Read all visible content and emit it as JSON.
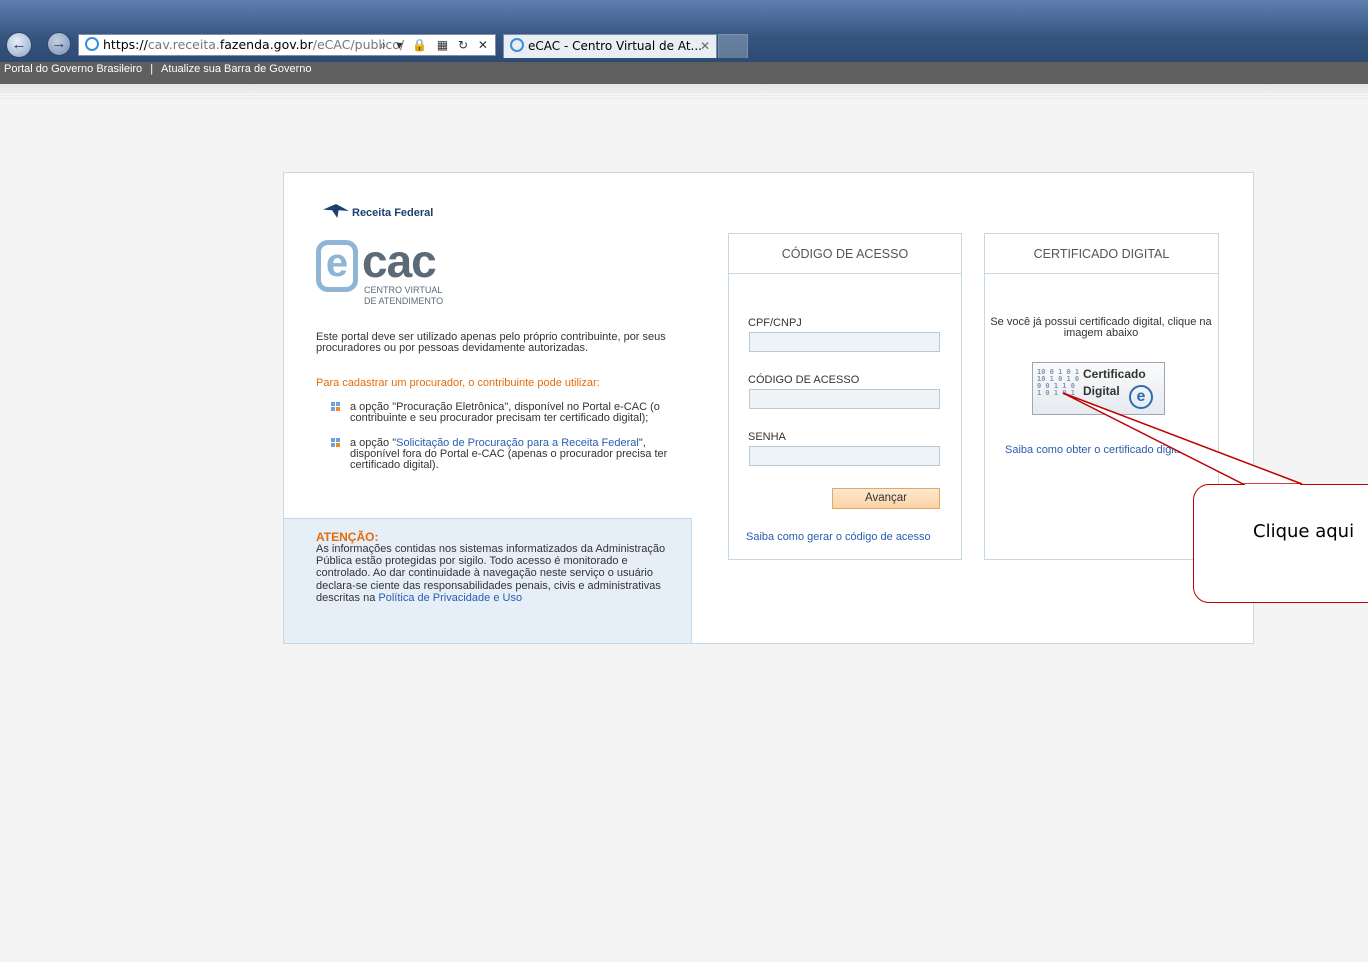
{
  "browser": {
    "back_icon": "←",
    "forward_icon": "→",
    "url_scheme": "https://",
    "url_pre": "cav.receita.",
    "url_host": "fazenda.gov.br",
    "url_path": "/eCAC/publico/",
    "addr_icons": "⌕ ▾ 🔒 ▦ ↻ ✕",
    "tab_title": "eCAC - Centro Virtual de At...",
    "tab_close": "✕"
  },
  "govbar": {
    "link1": "Portal do Governo Brasileiro",
    "separator": "|",
    "link2": "Atualize sua Barra de Governo"
  },
  "brand": {
    "receita": "Receita Federal",
    "ecac_e": "e",
    "ecac_cac": "cac",
    "sub1": "CENTRO VIRTUAL",
    "sub2": "DE ATENDIMENTO"
  },
  "intro": "Este portal deve ser utilizado apenas pelo próprio contribuinte, por seus procuradores ou por pessoas devidamente autorizadas.",
  "procurador": {
    "heading": "Para cadastrar um procurador, o contribuinte pode utilizar:",
    "item1": "a opção \"Procuração Eletrônica\", disponível no Portal e-CAC (o contribuinte e seu procurador precisam ter certificado digital);",
    "item2_pre": "a opção \"",
    "item2_link": "Solicitação de Procuração para a Receita Federal",
    "item2_post": "\", disponível fora do Portal e-CAC (apenas o procurador precisa ter certificado digital)."
  },
  "atencao": {
    "title": "ATENÇÃO:",
    "text": "As informações contidas nos sistemas informatizados da Administração Pública estão protegidas por sigilo. Todo acesso é monitorado e controlado. Ao dar continuidade à navegação neste serviço o usuário declara-se ciente das responsabilidades penais, civis e administrativas descritas na ",
    "link": "Política de Privacidade e Uso"
  },
  "codigo": {
    "title": "CÓDIGO DE ACESSO",
    "cpf_label": "CPF/CNPJ",
    "codigo_label": "CÓDIGO DE ACESSO",
    "senha_label": "SENHA",
    "button": "Avançar",
    "help_link": "Saiba como gerar o código de acesso"
  },
  "certificado": {
    "title": "CERTIFICADO DIGITAL",
    "instruction": "Se você já possui certificado digital, clique na imagem abaixo",
    "img_line1": "Certificado",
    "img_line2": "Digital",
    "img_e": "e",
    "img_binary": "10 0 1 0 1\n10 1 0 1 0\n0 0 1 1 0\n1 0 1 0 1",
    "help_link": "Saiba como obter o certificado digital"
  },
  "callout": {
    "text": "Clique aqui",
    "color": "#c00000"
  }
}
